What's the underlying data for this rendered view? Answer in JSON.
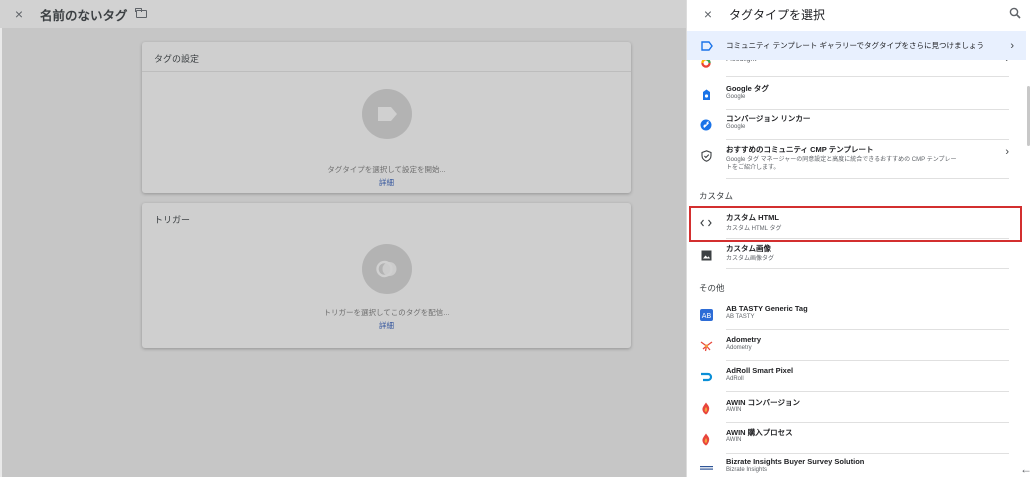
{
  "editor": {
    "close_glyph": "×",
    "title": "名前のないタグ",
    "tag_card": {
      "title": "タグの設定",
      "hint": "タグタイプを選択して設定を開始...",
      "more": "詳細"
    },
    "trigger_card": {
      "title": "トリガー",
      "hint": "トリガーを選択してこのタグを配信...",
      "more": "詳細"
    }
  },
  "panel": {
    "close_glyph": "×",
    "title": "タグタイプを選択",
    "banner": "コミュニティ テンプレート ギャラリーでタグタイプをさらに見つけましょう",
    "chevron": "›",
    "sections": {
      "custom": "カスタム",
      "other": "その他"
    },
    "items": [
      {
        "name": "Floodlight",
        "sub": "",
        "icon": "floodlight-icon",
        "chevron": true
      },
      {
        "name": "Google タグ",
        "sub": "Google",
        "icon": "google-tag-icon"
      },
      {
        "name": "コンバージョン リンカー",
        "sub": "Google",
        "icon": "conversion-linker-icon"
      },
      {
        "name": "おすすめのコミュニティ CMP テンプレート",
        "sub1": "Google タグ マネージャーの同意設定と高度に統合できるおすすめの CMP テンプレー",
        "sub2": "トをご紹介します。",
        "icon": "shield-check-icon",
        "chevron": true
      },
      {
        "name": "カスタム HTML",
        "sub": "カスタム HTML タグ",
        "icon": "code-icon"
      },
      {
        "name": "カスタム画像",
        "sub": "カスタム画像タグ",
        "icon": "image-icon"
      },
      {
        "name": "AB TASTY Generic Tag",
        "sub": "AB TASTY",
        "icon": "ab-tasty-icon"
      },
      {
        "name": "Adometry",
        "sub": "Adometry",
        "icon": "adometry-icon"
      },
      {
        "name": "AdRoll Smart Pixel",
        "sub": "AdRoll",
        "icon": "adroll-icon"
      },
      {
        "name": "AWIN コンバージョン",
        "sub": "AWIN",
        "icon": "awin-icon"
      },
      {
        "name": "AWIN 購入プロセス",
        "sub": "AWIN",
        "icon": "awin-icon"
      },
      {
        "name": "Bizrate Insights Buyer Survey Solution",
        "sub": "Bizrate Insights",
        "icon": "bizrate-icon"
      }
    ],
    "back_glyph": "←"
  },
  "colors": {
    "highlight": "#d32f2f",
    "banner_bg": "#e8f0fe",
    "link": "#33559d"
  }
}
